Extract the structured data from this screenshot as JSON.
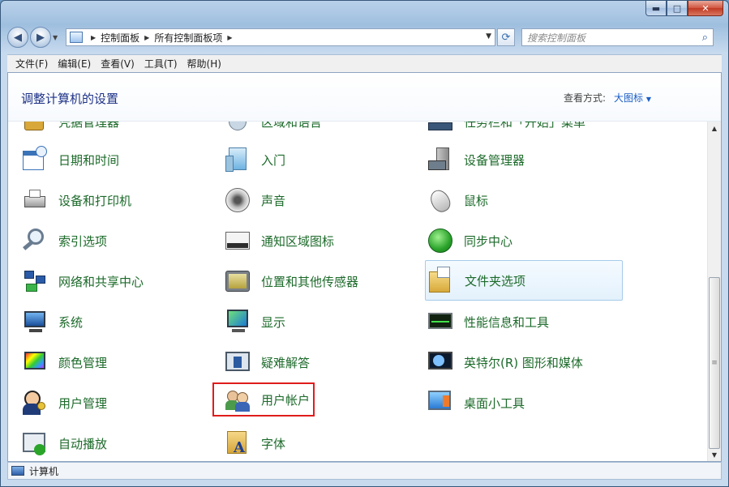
{
  "window": {
    "caption_buttons": [
      "minimize",
      "maximize",
      "close"
    ]
  },
  "address_bar": {
    "crumbs": [
      "控制面板",
      "所有控制面板项"
    ]
  },
  "search": {
    "placeholder": "搜索控制面板"
  },
  "menu": [
    "文件(F)",
    "编辑(E)",
    "查看(V)",
    "工具(T)",
    "帮助(H)"
  ],
  "header": {
    "title": "调整计算机的设置",
    "view_by_label": "查看方式:",
    "view_by_value": "大图标"
  },
  "partial_top_items": [
    "凭据管理器",
    "区域和语言",
    "任务栏和「开始」菜单"
  ],
  "items": [
    {
      "label": "日期和时间",
      "icon": "calendar-clock-icon"
    },
    {
      "label": "入门",
      "icon": "getting-started-icon"
    },
    {
      "label": "设备管理器",
      "icon": "device-manager-icon"
    },
    {
      "label": "设备和打印机",
      "icon": "printer-icon"
    },
    {
      "label": "声音",
      "icon": "speaker-icon"
    },
    {
      "label": "鼠标",
      "icon": "mouse-icon"
    },
    {
      "label": "索引选项",
      "icon": "indexing-magnifier-icon"
    },
    {
      "label": "通知区域图标",
      "icon": "notification-area-icon"
    },
    {
      "label": "同步中心",
      "icon": "sync-icon"
    },
    {
      "label": "网络和共享中心",
      "icon": "network-icon"
    },
    {
      "label": "位置和其他传感器",
      "icon": "location-sensor-icon"
    },
    {
      "label": "文件夹选项",
      "icon": "folder-options-icon"
    },
    {
      "label": "系统",
      "icon": "system-computer-icon"
    },
    {
      "label": "显示",
      "icon": "display-monitor-icon"
    },
    {
      "label": "性能信息和工具",
      "icon": "performance-icon"
    },
    {
      "label": "颜色管理",
      "icon": "color-management-icon"
    },
    {
      "label": "疑难解答",
      "icon": "troubleshooting-icon"
    },
    {
      "label": "英特尔(R) 图形和媒体",
      "icon": "intel-graphics-icon"
    },
    {
      "label": "用户管理",
      "icon": "user-management-icon"
    },
    {
      "label": "用户帐户",
      "icon": "user-accounts-icon"
    },
    {
      "label": "桌面小工具",
      "icon": "desktop-gadgets-icon"
    },
    {
      "label": "自动播放",
      "icon": "autoplay-icon"
    },
    {
      "label": "字体",
      "icon": "fonts-icon"
    }
  ],
  "status": {
    "text": "计算机"
  },
  "colors": {
    "link_green": "#1c6a2a",
    "title_blue": "#1e3287",
    "selection_red": "#e01c1c"
  }
}
